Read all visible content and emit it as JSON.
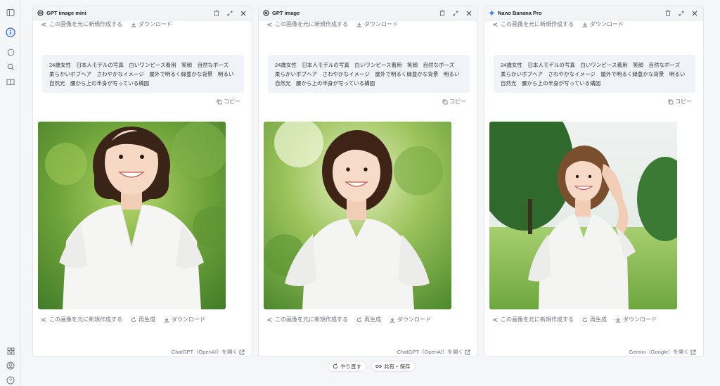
{
  "sidebar": {
    "icons": [
      "sidebar-toggle-icon",
      "info-icon",
      "chat-icon",
      "search-icon",
      "book-icon",
      "apps-icon",
      "user-icon",
      "help-icon"
    ]
  },
  "panels": [
    {
      "model": "GPT image mini",
      "model_icon": "openai-icon",
      "top_action": "この画像を元に新規作成する",
      "download": "ダウンロード",
      "prompt_lines": [
        "24歳女性　日本人モデルの写真　白いワンピース着用　笑顔　自然なポーズ",
        "柔らかいボブヘア　さわやかなイメージ　屋外で明るく緑豊かな背景　明るい",
        "自然光　腰から上の半身が写っている構図"
      ],
      "copy": "コピー",
      "bottom_actions": [
        "この画像を元に新規作成する",
        "再生成",
        "ダウンロード"
      ],
      "open_link": "ChatGPT（OpenAI）を開く"
    },
    {
      "model": "GPT image",
      "model_icon": "openai-icon",
      "top_action": "この画像を元に新規作成する",
      "download": "ダウンロード",
      "prompt_lines": [
        "24歳女性　日本人モデルの写真　白いワンピース着用　笑顔　自然なポーズ",
        "柔らかいボブヘア　さわやかなイメージ　屋外で明るく緑豊かな背景　明るい",
        "自然光　腰から上の半身が写っている構図"
      ],
      "copy": "コピー",
      "bottom_actions": [
        "この画像を元に新規作成する",
        "再生成",
        "ダウンロード"
      ],
      "open_link": "ChatGPT（OpenAI）を開く"
    },
    {
      "model": "Nano Banana Pro",
      "model_icon": "gemini-sparkle-icon",
      "top_action": "この画像を元に新規作成する",
      "download": "ダウンロード",
      "prompt_lines": [
        "24歳女性　日本人モデルの写真　白いワンピース着用　笑顔　自然なポーズ",
        "柔らかいボブヘア　さわやかなイメージ　屋外で明るく緑豊かな背景　明るい",
        "自然光　腰から上の半身が写っている構図"
      ],
      "copy": "コピー",
      "bottom_actions": [
        "この画像を元に新規作成する",
        "再生成",
        "ダウンロード"
      ],
      "open_link": "Gemini（Google）を開く"
    }
  ],
  "footer": {
    "redo": "やり直す",
    "share": "共有・保存"
  },
  "colors": {
    "accent": "#2563eb",
    "gemini": "#3b82f6"
  }
}
